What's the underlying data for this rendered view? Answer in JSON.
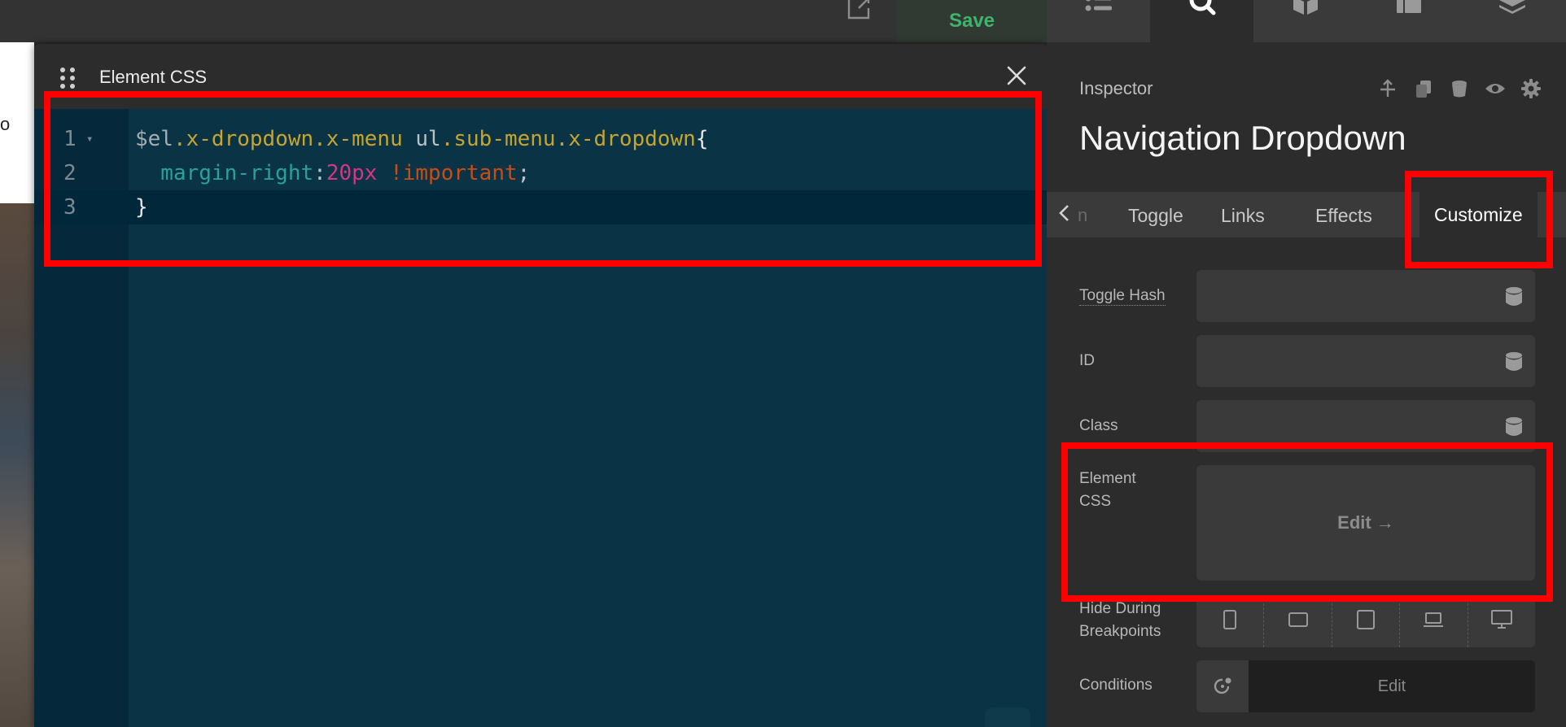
{
  "topbar": {
    "save_label": "Save",
    "open_icon": "external-link-icon"
  },
  "page_background": {
    "partial_text": "o"
  },
  "modal": {
    "title": "Element CSS",
    "close_icon": "close-icon",
    "editor": {
      "lines": [
        {
          "number": "1",
          "foldable": true,
          "tokens": [
            {
              "t": "$el",
              "c": "c-var"
            },
            {
              "t": ".x-dropdown.x-menu",
              "c": "c-sel"
            },
            {
              "t": " ul",
              "c": "c-plain"
            },
            {
              "t": ".sub-menu.x-dropdown",
              "c": "c-sel"
            },
            {
              "t": "{",
              "c": "c-brace"
            }
          ]
        },
        {
          "number": "2",
          "foldable": false,
          "tokens": [
            {
              "t": "  margin-right",
              "c": "c-prop"
            },
            {
              "t": ":",
              "c": "c-plain"
            },
            {
              "t": "20px",
              "c": "c-num"
            },
            {
              "t": " !important",
              "c": "c-imp"
            },
            {
              "t": ";",
              "c": "c-plain"
            }
          ]
        },
        {
          "number": "3",
          "foldable": false,
          "tokens": [
            {
              "t": "}",
              "c": "c-brace"
            }
          ]
        }
      ]
    }
  },
  "panel": {
    "top_tabs": [
      {
        "icon": "list-icon",
        "active": false
      },
      {
        "icon": "search-icon",
        "active": true
      },
      {
        "icon": "cube-icon",
        "active": false
      },
      {
        "icon": "layout-icon",
        "active": false
      },
      {
        "icon": "layers-icon",
        "active": false
      }
    ],
    "inspector_label": "Inspector",
    "inspector_actions": [
      "move-icon",
      "duplicate-icon",
      "delete-icon",
      "visibility-icon",
      "gear-icon"
    ],
    "element_title": "Navigation Dropdown",
    "subtabs": {
      "partial_first": "n",
      "items": [
        "Toggle",
        "Links",
        "Effects",
        "Customize"
      ],
      "active": "Customize"
    },
    "fields": {
      "toggle_hash_label": "Toggle Hash",
      "id_label": "ID",
      "class_label": "Class",
      "element_css_label_line1": "Element",
      "element_css_label_line2": "CSS",
      "element_css_edit_label": "Edit →",
      "hide_label_line1": "Hide During",
      "hide_label_line2": "Breakpoints",
      "breakpoints": [
        "phone-icon",
        "phone-landscape-icon",
        "tablet-icon",
        "laptop-icon",
        "desktop-icon"
      ],
      "conditions_label": "Conditions",
      "conditions_edit_label": "Edit"
    }
  },
  "annotation_color": "#ff0000"
}
